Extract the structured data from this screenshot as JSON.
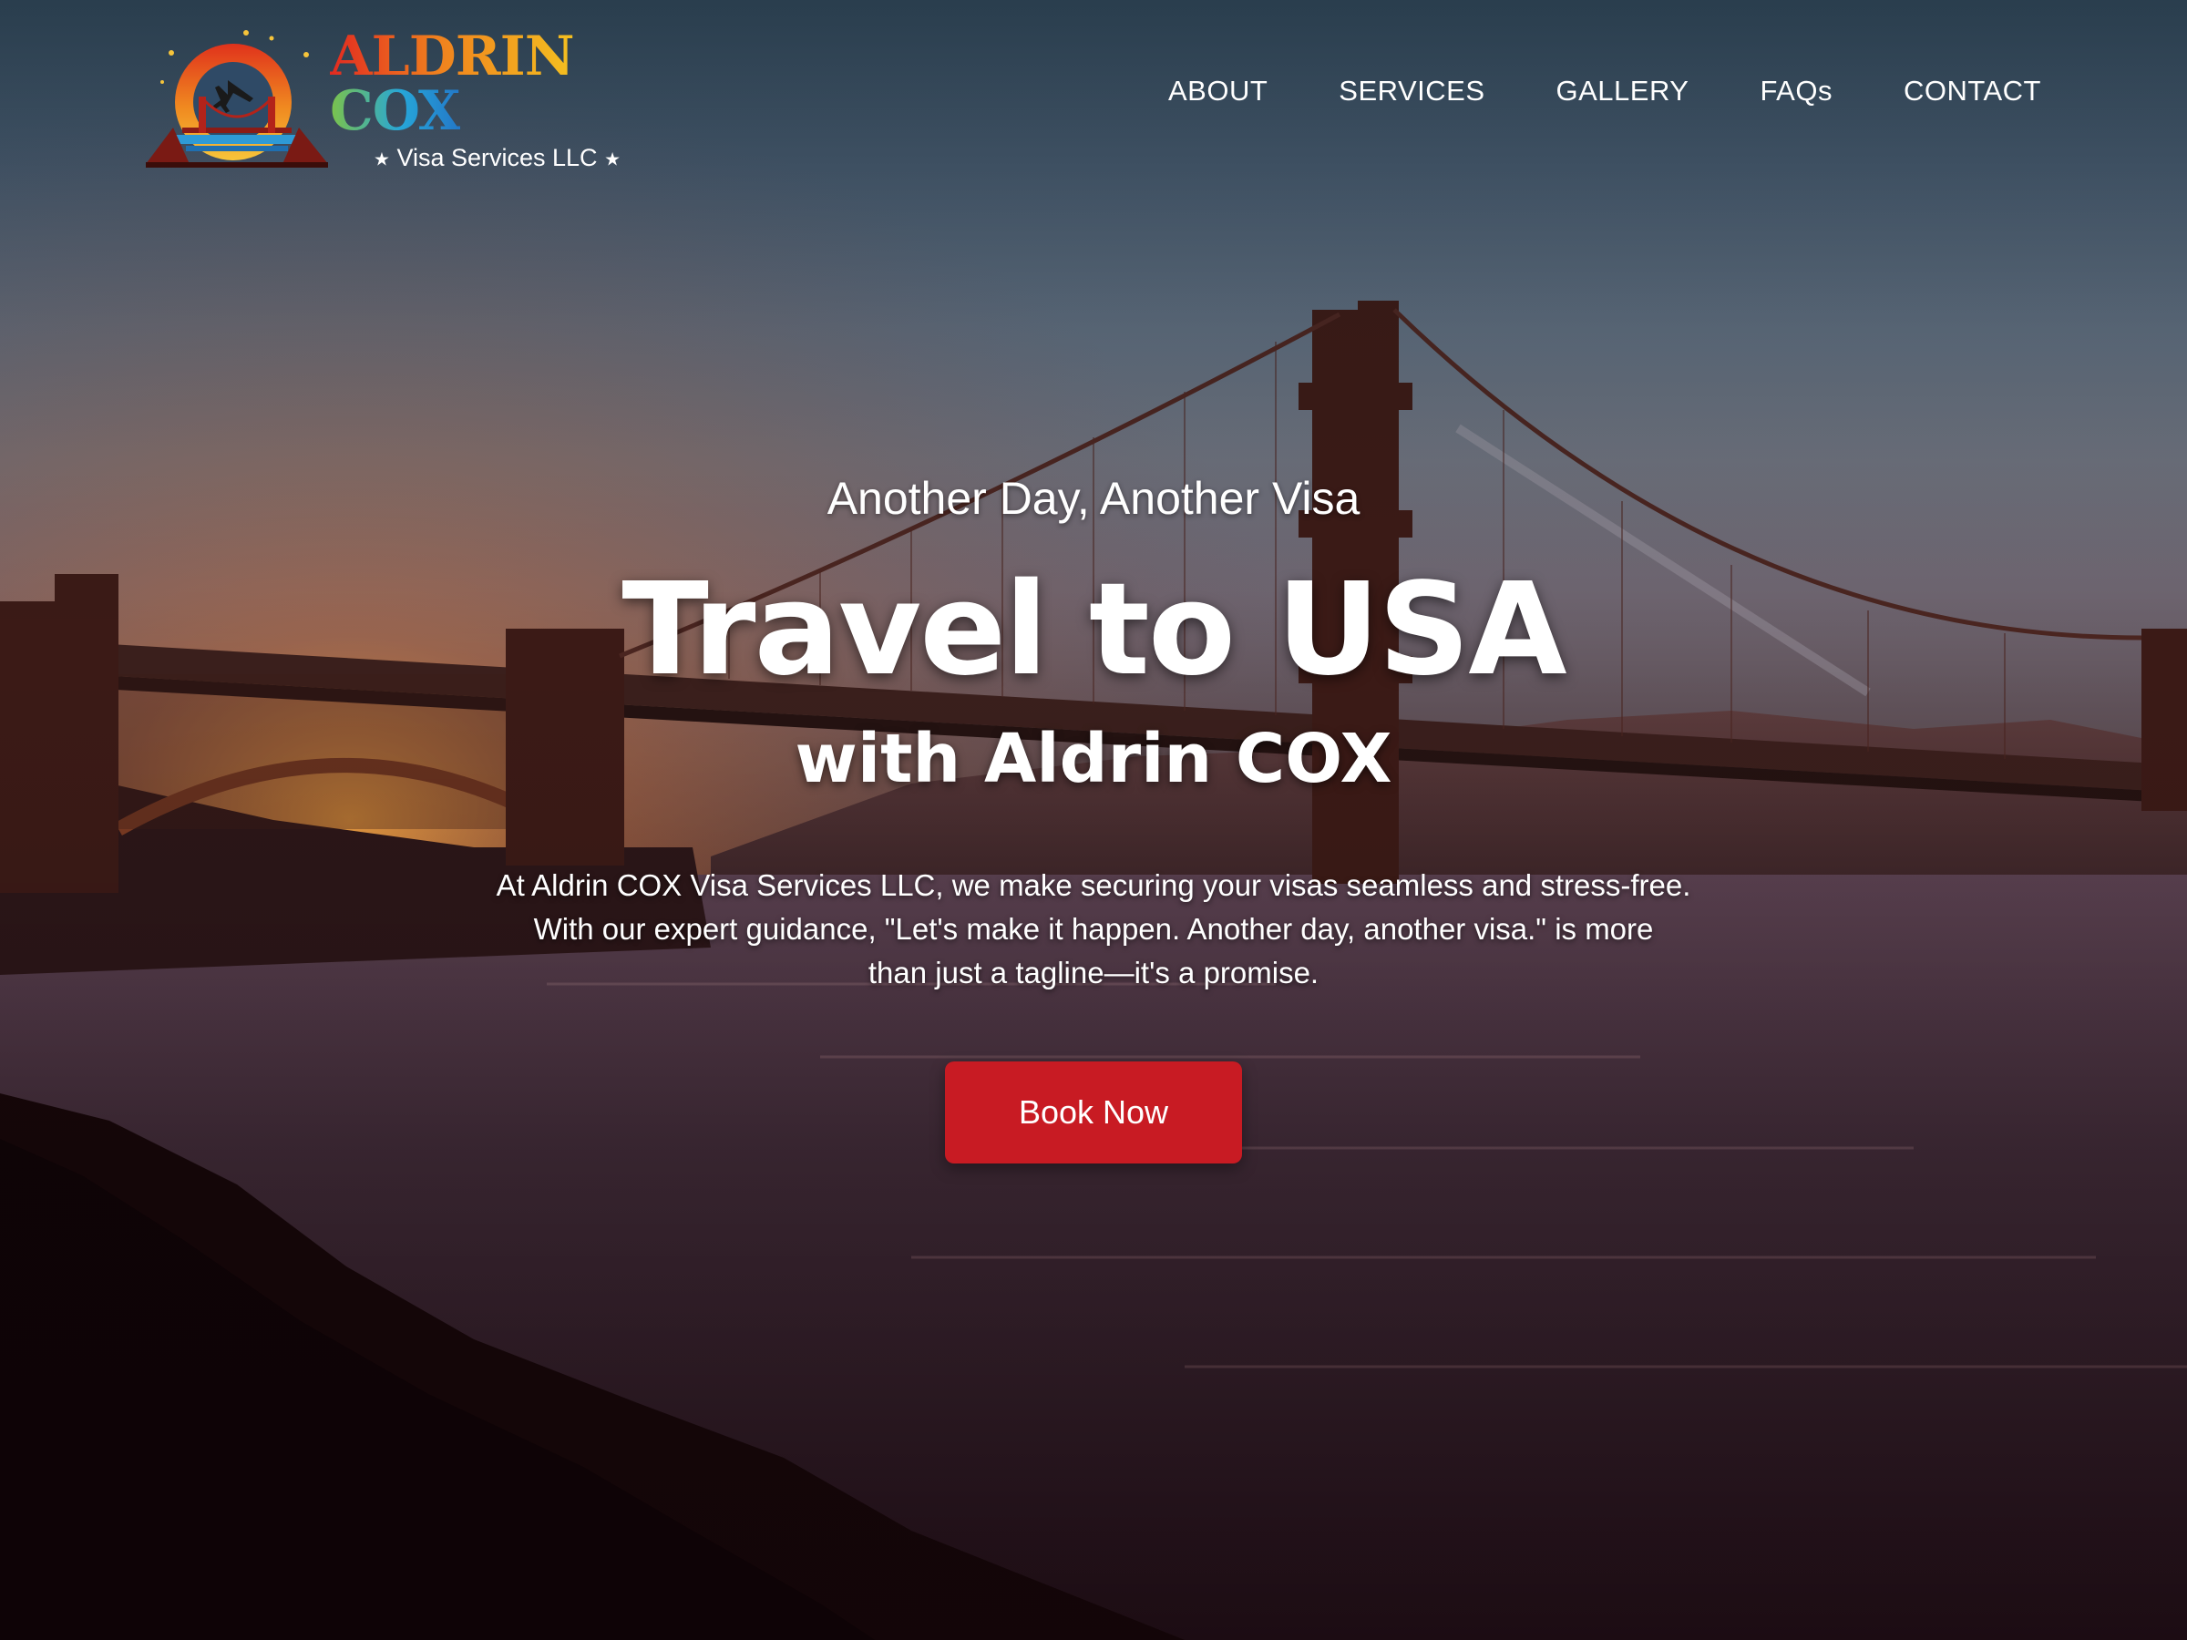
{
  "brand": {
    "name_part1": "ALDRIN",
    "name_part2": "COX",
    "subtitle": "Visa Services LLC"
  },
  "nav": {
    "items": [
      {
        "label": "ABOUT"
      },
      {
        "label": "SERVICES"
      },
      {
        "label": "GALLERY"
      },
      {
        "label": "FAQs"
      },
      {
        "label": "CONTACT"
      }
    ]
  },
  "hero": {
    "eyebrow": "Another Day, Another Visa",
    "title": "Travel to USA",
    "subtitle": "with Aldrin COX",
    "description_lines": [
      "At Aldrin COX Visa Services LLC, we make securing your visas seamless and stress-free.",
      "With our expert guidance, \"Let's make it happen. Another day, another visa.\" is more",
      "than just a tagline—it's a promise."
    ],
    "cta_label": "Book Now"
  },
  "colors": {
    "cta": "#c81b23",
    "text": "#ffffff",
    "brand_warm": "#e22a20",
    "brand_cool": "#26a6d9"
  },
  "icons": {
    "logo_emblem": "sun-bridge-airplane-emblem",
    "separator": "star-icon"
  }
}
